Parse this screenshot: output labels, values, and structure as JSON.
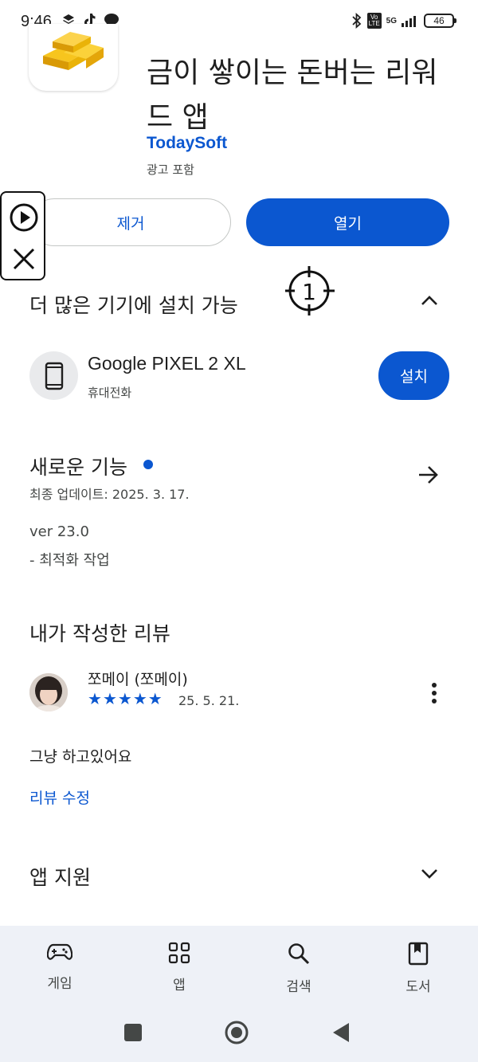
{
  "status_bar": {
    "time": "9:46",
    "volte": "Vo LTE",
    "network": "5G",
    "battery": "46"
  },
  "app": {
    "title": "금이 쌓이는 돈버는 리워드 앱",
    "developer": "TodaySoft",
    "ads_note": "광고 포함",
    "icon": "gold-bars-icon",
    "remove_label": "제거",
    "open_label": "열기"
  },
  "overlay": {
    "crosshair_number": "1"
  },
  "install_more": {
    "title": "더 많은 기기에 설치 가능",
    "device_name": "Google PIXEL 2 XL",
    "device_type": "휴대전화",
    "install_label": "설치"
  },
  "whats_new": {
    "title": "새로운 기능",
    "updated": "최종 업데이트: 2025. 3. 17.",
    "version": "ver 23.0",
    "notes": "- 최적화 작업"
  },
  "my_review": {
    "title": "내가 작성한 리뷰",
    "reviewer": "쪼메이 (쪼메이)",
    "rating": 5,
    "stars": [
      "★",
      "★",
      "★",
      "★",
      "★"
    ],
    "date": "25. 5. 21.",
    "text": "그냥 하고있어요",
    "edit_label": "리뷰 수정"
  },
  "app_support": {
    "title": "앱 지원"
  },
  "bottom_nav": {
    "items": [
      {
        "label": "게임",
        "icon": "gamepad-icon"
      },
      {
        "label": "앱",
        "icon": "apps-grid-icon"
      },
      {
        "label": "검색",
        "icon": "search-icon"
      },
      {
        "label": "도서",
        "icon": "bookmark-book-icon"
      }
    ]
  },
  "colors": {
    "accent": "#0b57d0",
    "text": "#1f1f1f",
    "secondary_text": "#444746",
    "nav_bg": "#eef1f7"
  }
}
